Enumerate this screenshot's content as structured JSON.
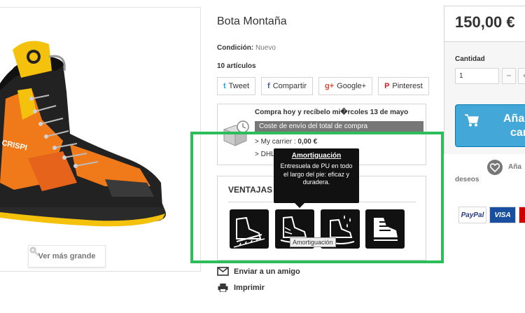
{
  "product": {
    "title": "Bota Montaña",
    "condition_label": "Condición:",
    "condition_value": "Nuevo",
    "stock": "10 artículos",
    "view_larger": "Ver más grande",
    "boot_brand": "CRISPI"
  },
  "social": [
    {
      "label": "Tweet",
      "icon": "twitter-icon",
      "glyph": "t",
      "color": "#1da1f2"
    },
    {
      "label": "Compartir",
      "icon": "facebook-icon",
      "glyph": "f",
      "color": "#3b5998"
    },
    {
      "label": "Google+",
      "icon": "google-plus-icon",
      "glyph": "g+",
      "color": "#dd4b39"
    },
    {
      "label": "Pinterest",
      "icon": "pinterest-icon",
      "glyph": "P",
      "color": "#cb2027"
    }
  ],
  "shipping": {
    "headline": "Compra hoy y recíbelo mi�rcoles 13 de mayo",
    "bar": "Coste de envío del total de compra",
    "carrier_label": "> My carrier : ",
    "carrier_value": "0,00 €",
    "carrier2": "> DHL"
  },
  "features": {
    "heading": "VENTAJAS",
    "tooltip_title": "Amortiguación",
    "tooltip_text": "Entresuela de PU en todo el largo del pie: eficaz y duradera.",
    "hover_hint": "Amortiguación"
  },
  "links": {
    "send_friend": "Enviar a un amigo",
    "print": "Imprimir"
  },
  "buy": {
    "price": "150,00 €",
    "qty_label": "Cantidad",
    "qty_value": "1",
    "minus": "−",
    "plus": "+",
    "add_line1": "Aña",
    "add_line2": "car",
    "wishlist": "Aña",
    "wishlist2": "deseos"
  },
  "payments": [
    {
      "label": "PayPal",
      "color": "#253b80"
    },
    {
      "label": "VISA",
      "color": "#ffffff",
      "bg": "#1a4fa0"
    },
    {
      "label": "",
      "color": "#ffffff",
      "bg": "#c00"
    }
  ],
  "colors": {
    "accent_blue": "#43a8d7",
    "highlight_green": "#2dbd5a",
    "tooltip_bg": "#111111"
  }
}
